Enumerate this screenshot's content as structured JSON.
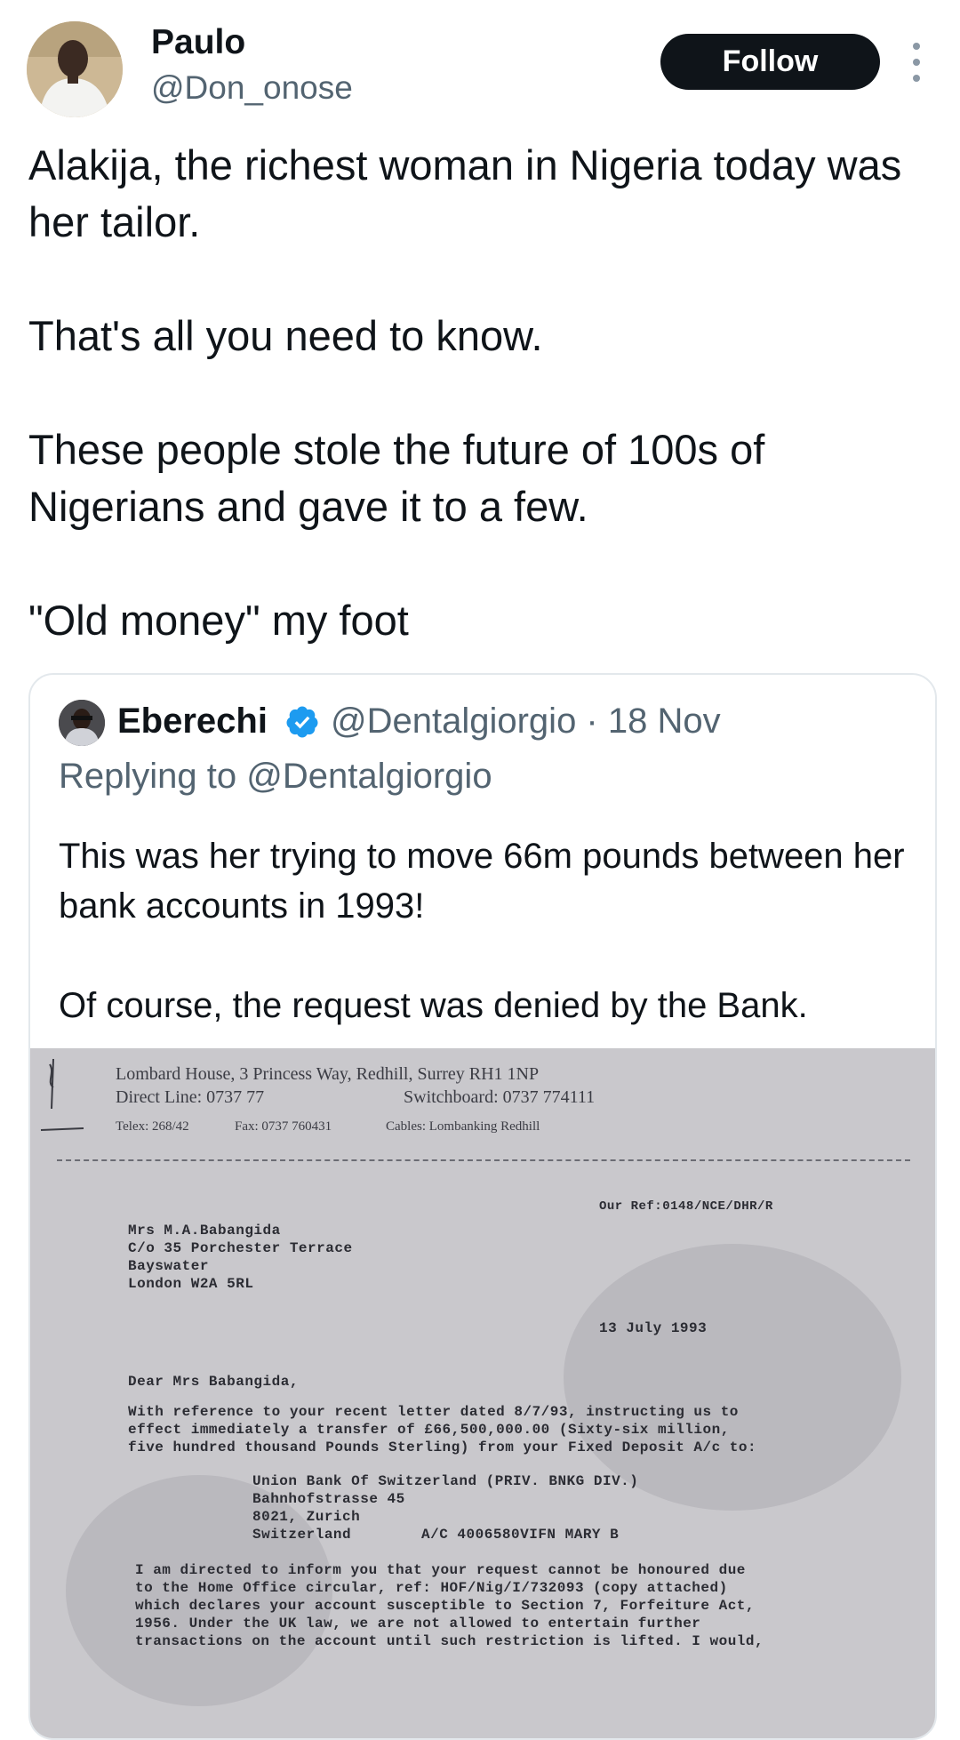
{
  "author": {
    "name": "Paulo",
    "handle": "@Don_onose"
  },
  "actions": {
    "follow_label": "Follow",
    "more_icon": "more-vertical-icon"
  },
  "tweet": {
    "paragraphs": [
      "Alakija, the richest woman in Nigeria today was her tailor.",
      "That's all you need to know.",
      "These people stole the future of 100s of Nigerians and gave it to a few.",
      "\"Old money\" my foot"
    ]
  },
  "quote": {
    "name": "Eberechi",
    "verified_icon": "verified-badge-icon",
    "handle_date": "@Dentalgiorgio · 18 Nov",
    "replying_prefix": "Replying to",
    "replying_to": "@Dentalgiorgio",
    "paragraphs": [
      "This was her trying to move 66m pounds between her bank accounts in 1993!",
      "Of course, the request was denied by the Bank."
    ],
    "image": {
      "letterhead_1": "Lombard House, 3 Princess Way, Redhill, Surrey RH1 1NP",
      "letterhead_2": "Direct Line: 0737 77",
      "letterhead_2b": "Switchboard: 0737 774111",
      "letterhead_3": "Telex: 268/42",
      "letterhead_3b": "Fax: 0737 760431",
      "letterhead_3c": "Cables: Lombanking Redhill",
      "ref": "Our Ref:0148/NCE/DHR/R",
      "address": [
        "Mrs M.A.Babangida",
        "C/o 35 Porchester Terrace",
        "Bayswater",
        "London W2A 5RL"
      ],
      "date": "13 July 1993",
      "salutation": "Dear Mrs Babangida,",
      "body_1": [
        "With reference to your recent letter dated 8/7/93, instructing us to",
        "effect immediately a transfer of £66,500,000.00 (Sixty-six million,",
        "five hundred thousand Pounds Sterling) from your Fixed Deposit A/c to:"
      ],
      "bank": [
        "Union Bank Of Switzerland (PRIV. BNKG DIV.)",
        "Bahnhofstrasse 45",
        "8021, Zurich",
        "Switzerland"
      ],
      "account": "A/C 4006580VIFN MARY B",
      "body_2": [
        "I am directed to inform you that your request cannot be honoured due",
        "to the Home Office circular, ref: HOF/Nig/I/732093 (copy attached)",
        "which declares your account susceptible to Section 7, Forfeiture Act,",
        "1956. Under the UK law, we are not allowed to entertain further",
        "transactions on the account until such restriction is lifted. I would,"
      ]
    }
  }
}
